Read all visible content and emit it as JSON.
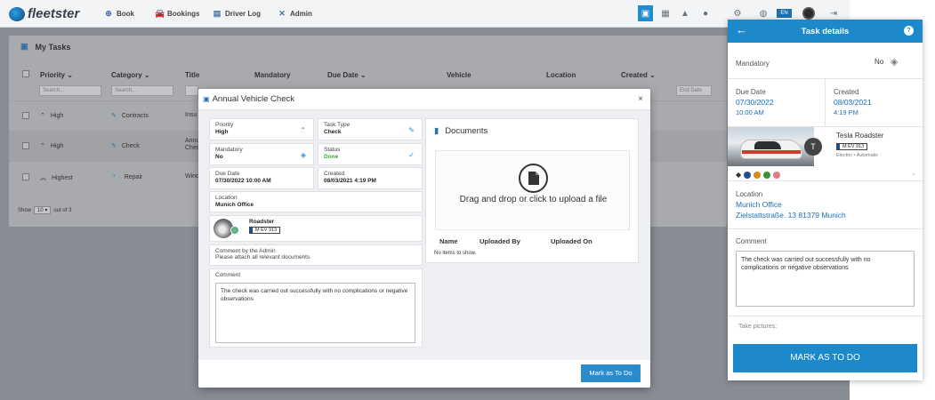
{
  "navbar": {
    "brand": "fleetster",
    "items": [
      {
        "label": "Book",
        "icon": "plus-circle-icon"
      },
      {
        "label": "Bookings",
        "icon": "car-icon"
      },
      {
        "label": "Driver Log",
        "icon": "logbook-icon"
      },
      {
        "label": "Admin",
        "icon": "tools-icon"
      }
    ],
    "language": "EN"
  },
  "tasks_page": {
    "title": "My Tasks",
    "columns": [
      "Priority",
      "Category",
      "Title",
      "Mandatory",
      "Due Date",
      "Vehicle",
      "Location",
      "Created"
    ],
    "filter_placeholder": "Search...",
    "end_date_placeholder": "End Date",
    "rows": [
      {
        "priority": "High",
        "category": "Contracts",
        "title": "Insu"
      },
      {
        "priority": "High",
        "category": "Check",
        "title": "Annu\nChec"
      },
      {
        "priority": "Highest",
        "category": "Repair",
        "title": "Winc"
      }
    ],
    "pager": {
      "show_label": "Show",
      "page_size": "10",
      "of_label": "out of 3"
    }
  },
  "modal": {
    "title": "Annual Vehicle Check",
    "close": "×",
    "fields": {
      "priority": {
        "label": "Priority",
        "value": "High"
      },
      "task_type": {
        "label": "Task Type",
        "value": "Check"
      },
      "mandatory": {
        "label": "Mandatory",
        "value": "No"
      },
      "status": {
        "label": "Status",
        "value": "Done"
      },
      "due_date": {
        "label": "Due Date",
        "value": "07/30/2022 10:00 AM"
      },
      "created": {
        "label": "Created",
        "value": "08/03/2021 4:19 PM"
      },
      "location": {
        "label": "Location",
        "value": "Munich Office"
      }
    },
    "vehicle": {
      "name": "Roadster",
      "plate": "M EV 913"
    },
    "admin_comment": {
      "label": "Comment by the Admin",
      "value": "Please attach all relevant documents"
    },
    "comment": {
      "label": "Comment",
      "value": "The check was carried out successfully with no complications or negative observations"
    },
    "documents": {
      "title": "Documents",
      "drop_text": "Drag and drop or click to upload a file",
      "columns": [
        "Name",
        "Uploaded By",
        "Uploaded On"
      ],
      "empty": "No items to show."
    },
    "action": "Mark as To Do"
  },
  "panel": {
    "title": "Task details",
    "mandatory": {
      "label": "Mandatory",
      "value": "No"
    },
    "due_date": {
      "label": "Due Date",
      "date": "07/30/2022",
      "time": "10:00 AM"
    },
    "created": {
      "label": "Created",
      "date": "08/03/2021",
      "time": "4:19 PM"
    },
    "vehicle": {
      "name": "Tesla Roadster",
      "plate": "M EV 913",
      "info": "Electric • Automatic"
    },
    "tag_colors": [
      "#1d4f91",
      "#d98a1c",
      "#3e8f3a",
      "#e07a8a"
    ],
    "location": {
      "label": "Location",
      "name": "Munich Office",
      "address": "Zielstattstraße. 13 81379 Munich"
    },
    "comment": {
      "label": "Comment",
      "value": "The check was carried out successfully with no complications or negative observations"
    },
    "pictures_label": "Take pictures:",
    "action": "MARK AS TO DO"
  },
  "colors": {
    "accent": "#1c89cb",
    "done": "#3fa535"
  }
}
